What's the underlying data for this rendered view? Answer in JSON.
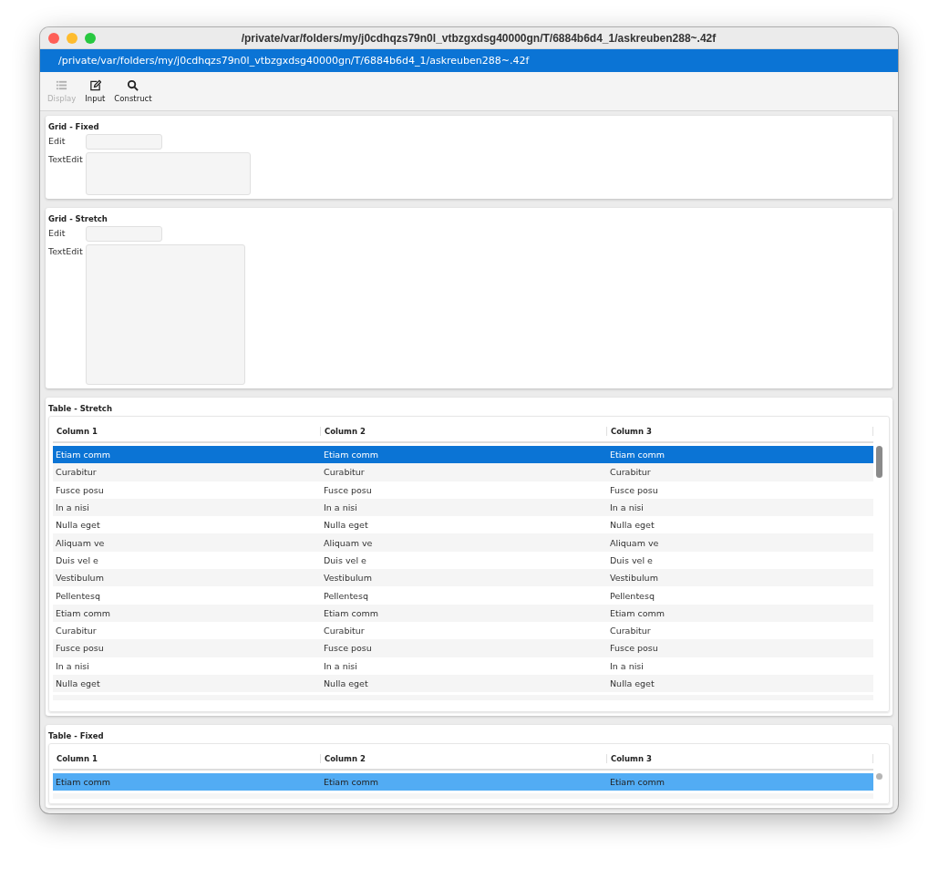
{
  "window": {
    "title": "/private/var/folders/my/j0cdhqzs79n0l_vtbzgxdsg40000gn/T/6884b6d4_1/askreuben288~.42f"
  },
  "path_bar": "/private/var/folders/my/j0cdhqzs79n0l_vtbzgxdsg40000gn/T/6884b6d4_1/askreuben288~.42f",
  "toolbar": [
    {
      "kind": "list",
      "label": "Display",
      "disabled": true
    },
    {
      "kind": "edit",
      "label": "Input",
      "disabled": false
    },
    {
      "kind": "search",
      "label": "Construct",
      "disabled": false
    }
  ],
  "sections": [
    {
      "kind": "grid",
      "title": "Grid - Fixed",
      "stretch": false,
      "fields": [
        {
          "kind": "line",
          "label": "Edit"
        },
        {
          "kind": "text",
          "label": "TextEdit"
        }
      ]
    },
    {
      "kind": "grid",
      "title": "Grid - Stretch",
      "stretch": true,
      "fields": [
        {
          "kind": "line",
          "label": "Edit"
        },
        {
          "kind": "text",
          "label": "TextEdit"
        }
      ]
    },
    {
      "kind": "table",
      "title": "Table - Stretch",
      "focused": true,
      "columns": [
        "Column 1",
        "Column 2",
        "Column 3"
      ],
      "rows": [
        {
          "cells": [
            "Etiam comm",
            "Etiam comm",
            "Etiam comm"
          ],
          "selected": true
        },
        {
          "cells": [
            "Curabitur",
            "Curabitur",
            "Curabitur"
          ],
          "selected": false
        },
        {
          "cells": [
            "Fusce posu",
            "Fusce posu",
            "Fusce posu"
          ],
          "selected": false
        },
        {
          "cells": [
            "In a nisi",
            "In a nisi",
            "In a nisi"
          ],
          "selected": false
        },
        {
          "cells": [
            "Nulla eget",
            "Nulla eget",
            "Nulla eget"
          ],
          "selected": false
        },
        {
          "cells": [
            "Aliquam ve",
            "Aliquam ve",
            "Aliquam ve"
          ],
          "selected": false
        },
        {
          "cells": [
            "Duis vel e",
            "Duis vel e",
            "Duis vel e"
          ],
          "selected": false
        },
        {
          "cells": [
            "Vestibulum",
            "Vestibulum",
            "Vestibulum"
          ],
          "selected": false
        },
        {
          "cells": [
            "Pellentesq",
            "Pellentesq",
            "Pellentesq"
          ],
          "selected": false
        },
        {
          "cells": [
            "Etiam comm",
            "Etiam comm",
            "Etiam comm"
          ],
          "selected": false
        },
        {
          "cells": [
            "Curabitur",
            "Curabitur",
            "Curabitur"
          ],
          "selected": false
        },
        {
          "cells": [
            "Fusce posu",
            "Fusce posu",
            "Fusce posu"
          ],
          "selected": false
        },
        {
          "cells": [
            "In a nisi",
            "In a nisi",
            "In a nisi"
          ],
          "selected": false
        },
        {
          "cells": [
            "Nulla eget",
            "Nulla eget",
            "Nulla eget"
          ],
          "selected": false
        }
      ]
    },
    {
      "kind": "table",
      "title": "Table - Fixed",
      "focused": false,
      "columns": [
        "Column 1",
        "Column 2",
        "Column 3"
      ],
      "rows": [
        {
          "cells": [
            "Etiam comm",
            "Etiam comm",
            "Etiam comm"
          ],
          "selected": true
        }
      ]
    }
  ]
}
